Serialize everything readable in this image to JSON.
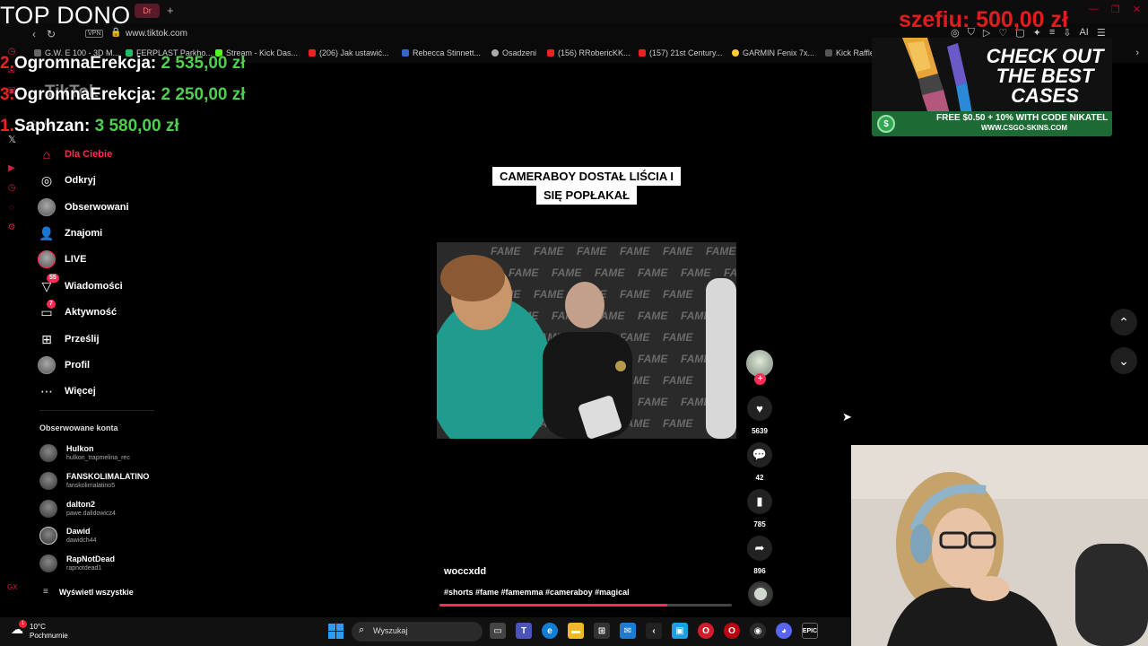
{
  "browser": {
    "url": "www.tiktok.com",
    "vpn_label": "VPN",
    "tab_label": "TikTok",
    "bookmarks": [
      {
        "label": "G.W. E 100 - 3D M..."
      },
      {
        "label": "FERPLAST Parkho..."
      },
      {
        "label": "Stream - Kick Das..."
      },
      {
        "label": "(206) Jak ustawić..."
      },
      {
        "label": "Rebecca Stinnett..."
      },
      {
        "label": "Osadzeni"
      },
      {
        "label": "(156) RRobericKK..."
      },
      {
        "label": "(157) 21st Century..."
      },
      {
        "label": "GARMIN Fenix 7x..."
      },
      {
        "label": "Kick Raffle"
      }
    ],
    "toolbar_ai": "AI"
  },
  "stream_overlay": {
    "top_title": "TOP DONO",
    "ranking": [
      {
        "num": "2.",
        "name": "OgromnaErekcja: ",
        "amount": "2 535,00 zł"
      },
      {
        "num": "3.",
        "name": "OgromnaErekcja: ",
        "amount": "2 250,00 zł"
      },
      {
        "num": "1.",
        "name": "Saphzan: ",
        "amount": "3 580,00 zł"
      }
    ],
    "top_donor": "szefiu: 500,00 zł",
    "tiktok_logo": "TikTok"
  },
  "ad": {
    "title": "CHECK OUT THE BEST CASES",
    "promo": "FREE $0.50 + 10% WITH CODE NIKATEL",
    "site": "WWW.CSGO-SKINS.COM",
    "coin_symbol": "$"
  },
  "search": {
    "placeholder": "Szukaj"
  },
  "sidebar": {
    "items": [
      {
        "label": "Dla Ciebie",
        "icon": "home-icon"
      },
      {
        "label": "Odkryj",
        "icon": "compass-icon"
      },
      {
        "label": "Obserwowani",
        "icon": "avatar"
      },
      {
        "label": "Znajomi",
        "icon": "friends-icon"
      },
      {
        "label": "LIVE",
        "icon": "avatar"
      },
      {
        "label": "Wiadomości",
        "icon": "messages-icon",
        "badge": "55"
      },
      {
        "label": "Aktywność",
        "icon": "activity-icon",
        "badge": "7"
      },
      {
        "label": "Prześlij",
        "icon": "upload-icon"
      },
      {
        "label": "Profil",
        "icon": "avatar"
      },
      {
        "label": "Więcej",
        "icon": "more-icon"
      }
    ],
    "following_title": "Obserwowane konta",
    "following": [
      {
        "name": "Hulkon",
        "user": "hulkon_trapmelina_rec"
      },
      {
        "name": "FANSKOLIMALATINO",
        "user": "fanskolimalatino5"
      },
      {
        "name": "dalton2",
        "user": "pawe.dalidowicz4"
      },
      {
        "name": "Dawid",
        "user": "dawidch44"
      },
      {
        "name": "RapNotDead",
        "user": "rapnotdead1"
      }
    ],
    "see_all": "Wyświetl wszystkie"
  },
  "video": {
    "caption_line1": "CAMERABOY DOSTAŁ LIŚCIA I",
    "caption_line2": "SIĘ POPŁAKAŁ",
    "author": "woccxdd",
    "hashtags": "#shorts #fame #famemma #cameraboy #magical",
    "progress": 0.78,
    "backdrop_word": "FAME",
    "likes": "5639",
    "comments": "42",
    "saves": "785",
    "shares": "896"
  },
  "taskbar": {
    "temp": "10°C",
    "weather": "Pochmurnie",
    "weather_badge": "1",
    "search_label": "Wyszukaj"
  }
}
